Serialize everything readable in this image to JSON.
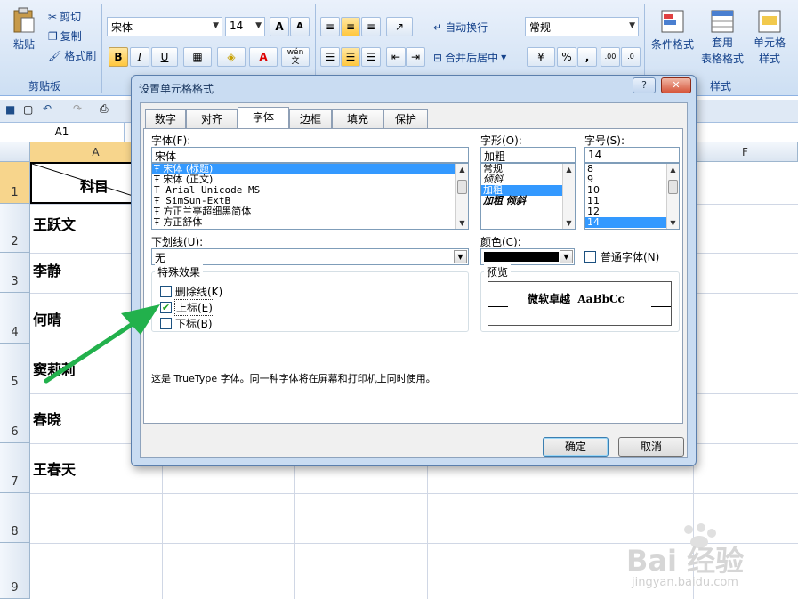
{
  "ribbon": {
    "clipboard": {
      "paste": "粘贴",
      "cut": "剪切",
      "copy": "复制",
      "format_painter": "格式刷",
      "group_label": "剪贴板"
    },
    "font": {
      "name": "宋体",
      "size": "14",
      "grow": "A",
      "shrink": "A",
      "bold": "B",
      "italic": "I",
      "underline": "U",
      "font_color_letter": "A",
      "phonetic": "文",
      "phonetic_top": "wén"
    },
    "align": {
      "wrap": "自动换行",
      "merge": "合并后居中"
    },
    "number": {
      "format": "常规",
      "percent": "%",
      "comma": ",",
      "inc_dec": ".00",
      "dec_dec": ".0"
    },
    "styles": {
      "conditional": "条件格式",
      "table_line1": "套用",
      "table_line2": "表格格式",
      "cell_line1": "单元格",
      "cell_line2": "样式",
      "group_label": "样式"
    }
  },
  "sheet": {
    "name_box": "A1",
    "columns": [
      "A",
      "F"
    ],
    "rows": [
      "1",
      "2",
      "3",
      "4",
      "5",
      "6",
      "7",
      "8",
      "9"
    ],
    "cells": {
      "a1": "科目",
      "a2": "王跃文",
      "a3": "李静",
      "a4": "何晴",
      "a5": "窦莉莉",
      "a6": "春晓",
      "a7": "王春天"
    }
  },
  "dialog": {
    "title": "设置单元格格式",
    "help": "?",
    "tabs": [
      "数字",
      "对齐",
      "字体",
      "边框",
      "填充",
      "保护"
    ],
    "font_label": "字体(F):",
    "font_value": "宋体",
    "font_list": [
      "宋体 (标题)",
      "宋体 (正文)",
      "Arial Unicode MS",
      "SimSun-ExtB",
      "方正兰亭超细黑简体",
      "方正舒体"
    ],
    "style_label": "字形(O):",
    "style_value": "加粗",
    "style_list": [
      "常规",
      "倾斜",
      "加粗",
      "加粗 倾斜"
    ],
    "size_label": "字号(S):",
    "size_value": "14",
    "size_list": [
      "8",
      "9",
      "10",
      "11",
      "12",
      "14"
    ],
    "underline_label": "下划线(U):",
    "underline_value": "无",
    "color_label": "颜色(C):",
    "normal_font": "普通字体(N)",
    "effects_label": "特殊效果",
    "strike": "删除线(K)",
    "superscript": "上标(E)",
    "subscript": "下标(B)",
    "preview_label": "预览",
    "preview_text": "微软卓越  AaBbCc",
    "info": "这是 TrueType 字体。同一种字体将在屏幕和打印机上同时使用。",
    "ok": "确定",
    "cancel": "取消"
  },
  "watermark": {
    "brand": "Bai 经验",
    "url": "jingyan.baidu.com"
  },
  "colors": {
    "arrow": "#22b14c",
    "selection": "#3399ff",
    "ribbon_text": "#15428b"
  }
}
